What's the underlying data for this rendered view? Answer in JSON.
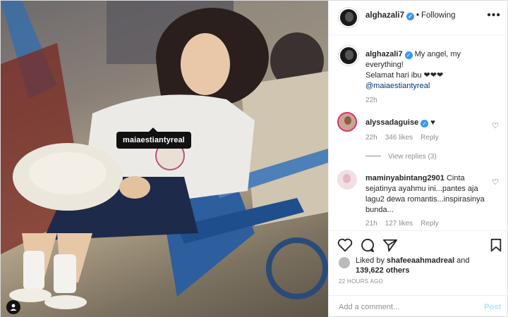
{
  "post": {
    "author": "alghazali7",
    "follow_status": "Following",
    "more_icon": "ellipsis-icon",
    "photo_tag": "maiaestiantyreal",
    "caption": {
      "username": "alghazali7",
      "text_line1": "My angel, my everything!",
      "text_line2": "Selamat hari ibu ❤❤❤",
      "mention": "@maiaestiantyreal",
      "time": "22h"
    },
    "comments": [
      {
        "username": "alyssadaguise",
        "text": "♥",
        "time": "22h",
        "likes": "346 likes",
        "reply": "Reply",
        "view_replies": "View replies (3)"
      },
      {
        "username": "maminyabintang2901",
        "text": "Cinta sejatinya ayahmu ini...pantes aja lagu2 dewa romantis...inspirasinya bunda...",
        "time": "21h",
        "likes": "127 likes",
        "reply": "Reply"
      }
    ],
    "likes": {
      "prefix": "Liked by",
      "user": "shafeeaahmadreal",
      "and": "and",
      "others": "139,622 others"
    },
    "posted": "22 HOURS AGO",
    "add_comment_placeholder": "Add a comment...",
    "post_button": "Post"
  },
  "colors": {
    "verified": "#3897f0",
    "post_disabled": "#b2dffc",
    "meta": "#8e8e8e"
  }
}
